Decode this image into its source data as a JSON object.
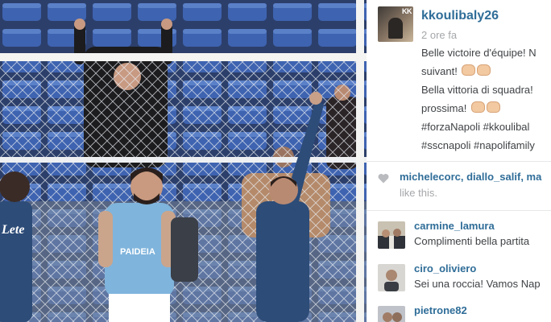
{
  "post": {
    "username": "kkoulibaly26",
    "time_ago": "2 ore fa",
    "caption_lines": [
      "Belle victoire d'équipe! N",
      "suivant! ",
      "Bella vittoria di squadra!",
      "prossima! ",
      "#forzaNapoli #kkoulibal",
      "#sscnapoli #napolifamily"
    ],
    "avatar_badge": "KK",
    "likes": {
      "likers": [
        "michelecorc",
        "diallo_salif",
        "ma"
      ],
      "suffix": "like this."
    }
  },
  "comments": [
    {
      "user": "carmine_lamura",
      "text": "Complimenti bella partita"
    },
    {
      "user": "ciro_oliviero",
      "text": "Sei una roccia! Vamos Nap"
    },
    {
      "user": "pietrone82",
      "text": ""
    }
  ],
  "photo": {
    "shirt_left_text": "Lete",
    "shirt_center_text": "PAIDEIA"
  },
  "colors": {
    "link_blue": "#2f6d98",
    "text_dark": "#3f4245",
    "text_muted": "#a5a7aa",
    "stadium_seat_blue": "#3e63b0",
    "napoli_kit": "#2d4c78",
    "lazio_kit": "#7fb4dc"
  },
  "icons": {
    "like": "heart-icon",
    "emoji": "clapping-hands-emoji"
  }
}
